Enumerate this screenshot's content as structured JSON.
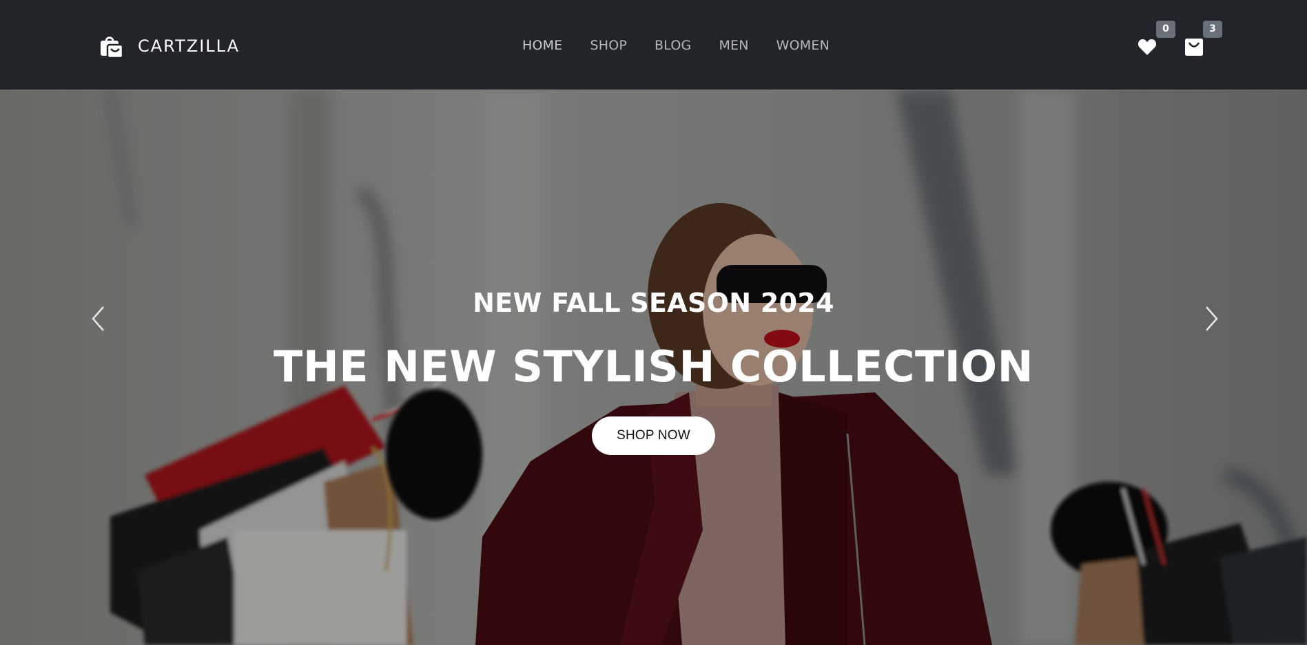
{
  "header": {
    "brand": {
      "name": "CARTZILLA",
      "icon": "shopping-bag-icon"
    },
    "nav": [
      {
        "label": "HOME"
      },
      {
        "label": "SHOP"
      },
      {
        "label": "BLOG"
      },
      {
        "label": "MEN"
      },
      {
        "label": "WOMEN"
      }
    ],
    "wishlist": {
      "icon": "heart-icon",
      "count": "0"
    },
    "cart": {
      "icon": "cart-bag-icon",
      "count": "3"
    }
  },
  "hero": {
    "subtitle": "NEW FALL SEASON 2024",
    "title": "THE NEW STYLISH COLLECTION",
    "cta_label": "SHOP NOW",
    "prev_icon": "chevron-left-icon",
    "next_icon": "chevron-right-icon"
  },
  "colors": {
    "header_bg": "#212429",
    "badge_bg": "#6a7079",
    "nav_text": "#b6b9bd",
    "button_bg": "#ffffff"
  }
}
